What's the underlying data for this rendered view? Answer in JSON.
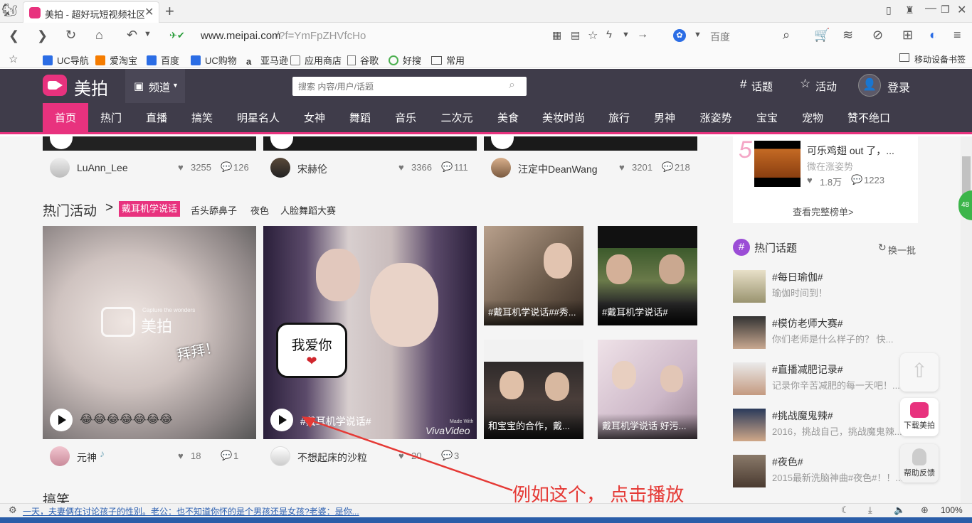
{
  "browser": {
    "tab_title": "美拍 - 超好玩短视频社区",
    "url_domain": "www.meipai.com",
    "url_path": "/?f=YmFpZHVfcHo",
    "search_engine": "百度",
    "bookmarks": [
      "UC导航",
      "爱淘宝",
      "百度",
      "UC购物",
      "亚马逊",
      "应用商店",
      "谷歌",
      "好搜",
      "常用"
    ],
    "mobile_label": "移动设备书签"
  },
  "header": {
    "logo_text": "美拍",
    "channel_label": "频道",
    "search_placeholder": "搜索 内容/用户/话题",
    "topics_label": "话题",
    "activity_label": "活动",
    "login_label": "登录"
  },
  "nav": {
    "items": [
      "首页",
      "热门",
      "直播",
      "搞笑",
      "明星名人",
      "女神",
      "舞蹈",
      "音乐",
      "二次元",
      "美食",
      "美妆时尚",
      "旅行",
      "男神",
      "涨姿势",
      "宝宝",
      "宠物",
      "赞不绝口"
    ],
    "active_index": 0
  },
  "top_row": [
    {
      "user": "LuAnn_Lee",
      "likes": "3255",
      "comments": "126"
    },
    {
      "user": "宋赫伦",
      "likes": "3366",
      "comments": "111"
    },
    {
      "user": "汪定中DeanWang",
      "likes": "3201",
      "comments": "218"
    }
  ],
  "hot_activity": {
    "title": "热门活动",
    "arrow": ">",
    "active_tag": "戴耳机学说话",
    "tags": [
      "舌头舔鼻子",
      "夜色",
      "人脸舞蹈大赛"
    ]
  },
  "videos": {
    "v1": {
      "user": "元神",
      "likes": "18",
      "comments": "1",
      "emoji": "😂😂😂😂😂😂😂",
      "watermark": "美拍",
      "overlay_text": "拜拜！",
      "small_text": "Capture the wonders"
    },
    "v2": {
      "caption": "#戴耳机学说话#",
      "user": "不想起床的沙粒",
      "likes": "20",
      "comments": "3",
      "bubble": "我爱你",
      "made_with": "Made With",
      "viva": "VivaVideo"
    },
    "v3": {
      "caption": "#戴耳机学说话##秀..."
    },
    "v4": {
      "caption": "#戴耳机学说话#"
    },
    "v5": {
      "caption": "和宝宝的合作，戴..."
    },
    "v6": {
      "caption": "戴耳机学说话 好污..."
    }
  },
  "rank": {
    "number": "5",
    "title": "可乐鸡翅 out 了，...",
    "sub": "微在涨姿势",
    "likes": "1.8万",
    "comments": "1223",
    "more": "查看完整榜单>"
  },
  "hot_topics": {
    "title": "热门话题",
    "refresh": "换一批",
    "items": [
      {
        "title": "#每日瑜伽#",
        "desc": "瑜伽时间到！"
      },
      {
        "title": "#模仿老师大赛#",
        "desc": "你们老师是什么样子的？ 快..."
      },
      {
        "title": "#直播减肥记录#",
        "desc": "记录你辛苦减肥的每一天吧！..."
      },
      {
        "title": "#挑战魔鬼辣#",
        "desc": "2016，挑战自己，挑战魔鬼辣..."
      },
      {
        "title": "#夜色#",
        "desc": "2015最新洗脑神曲#夜色#！！..."
      }
    ]
  },
  "float": {
    "download": "下载美拍",
    "help": "帮助反馈",
    "badge": "48"
  },
  "section_next": "搞笑",
  "annotation": "例如这个， 点击播放",
  "statusbar": {
    "ticker": "一天，夫妻俩在讨论孩子的性别。老公：也不知道你怀的是个男孩还是女孩?老婆：是你...",
    "zoom": "100%"
  },
  "colors": {
    "brand": "#e8327e",
    "header_bg": "#3f3c4a",
    "annotation": "#e53935"
  }
}
